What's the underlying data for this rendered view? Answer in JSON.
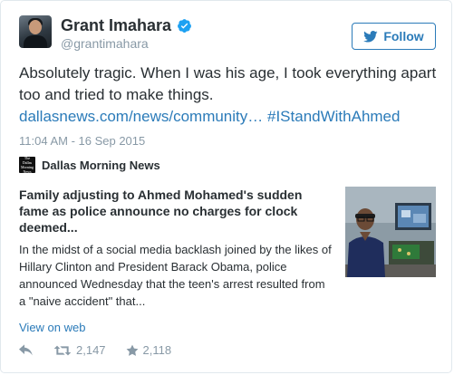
{
  "author": {
    "name": "Grant Imahara",
    "handle": "@grantimahara",
    "verified": true
  },
  "follow_button": {
    "label": "Follow",
    "icon": "twitter-bird-icon"
  },
  "tweet": {
    "text_line1": "Absolutely tragic. When I was his age, I took everything apart",
    "text_line2": "too and tried to make things.",
    "link_text": "dallasnews.com/news/community…",
    "hashtag": "#IStandWithAhmed",
    "timestamp": "11:04 AM - 16 Sep 2015"
  },
  "card": {
    "source_logo_text": "The Dallas Morning News",
    "source_name": "Dallas Morning News",
    "title": "Family adjusting to Ahmed Mohamed's sudden fame as police announce no charges for clock deemed...",
    "description": "In the midst of a social media backlash joined by the likes of Hillary Clinton and President Barack Obama, police announced Wednesday that the teen's arrest resulted from a \"naive accident\" that...",
    "view_link": "View on web"
  },
  "actions": {
    "reply_icon": "reply-icon",
    "retweet_icon": "retweet-icon",
    "retweet_count": "2,147",
    "favorite_icon": "star-icon",
    "favorite_count": "2,118"
  },
  "colors": {
    "accent": "#2b7bb9",
    "text": "#292f33",
    "muted": "#8899a6",
    "border": "#e1e8ed",
    "verified": "#1da1f2"
  }
}
